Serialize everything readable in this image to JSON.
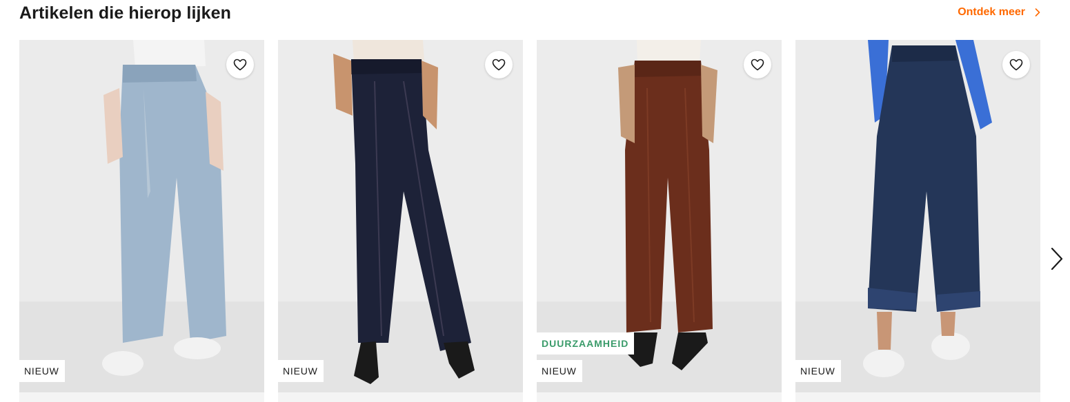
{
  "section": {
    "title": "Artikelen die hierop lijken",
    "discover_label": "Ontdek meer",
    "accent_color": "#ff6900"
  },
  "products": [
    {
      "badges": [
        {
          "type": "new",
          "label": "NIEUW"
        }
      ],
      "jeans_color": "#9fb6cc",
      "top_color": "#f4f4f4",
      "shoe_color": "#f2f2f2",
      "favorite_icon": "heart-outline-icon"
    },
    {
      "badges": [
        {
          "type": "new",
          "label": "NIEUW"
        }
      ],
      "jeans_color": "#1d2238",
      "top_color": "#efe6dc",
      "shoe_color": "#1a1a1a",
      "favorite_icon": "heart-outline-icon"
    },
    {
      "badges": [
        {
          "type": "eco",
          "label": "DUURZAAMHEID"
        },
        {
          "type": "new",
          "label": "NIEUW"
        }
      ],
      "jeans_color": "#6b2e1c",
      "top_color": "#f3efe9",
      "shoe_color": "#1a1a1a",
      "favorite_icon": "heart-outline-icon"
    },
    {
      "badges": [
        {
          "type": "new",
          "label": "NIEUW"
        }
      ],
      "jeans_color": "#243658",
      "top_color": "#3a6fd6",
      "shoe_color": "#f2f2f2",
      "favorite_icon": "heart-outline-icon"
    }
  ],
  "carousel": {
    "next_icon": "chevron-right-icon"
  }
}
